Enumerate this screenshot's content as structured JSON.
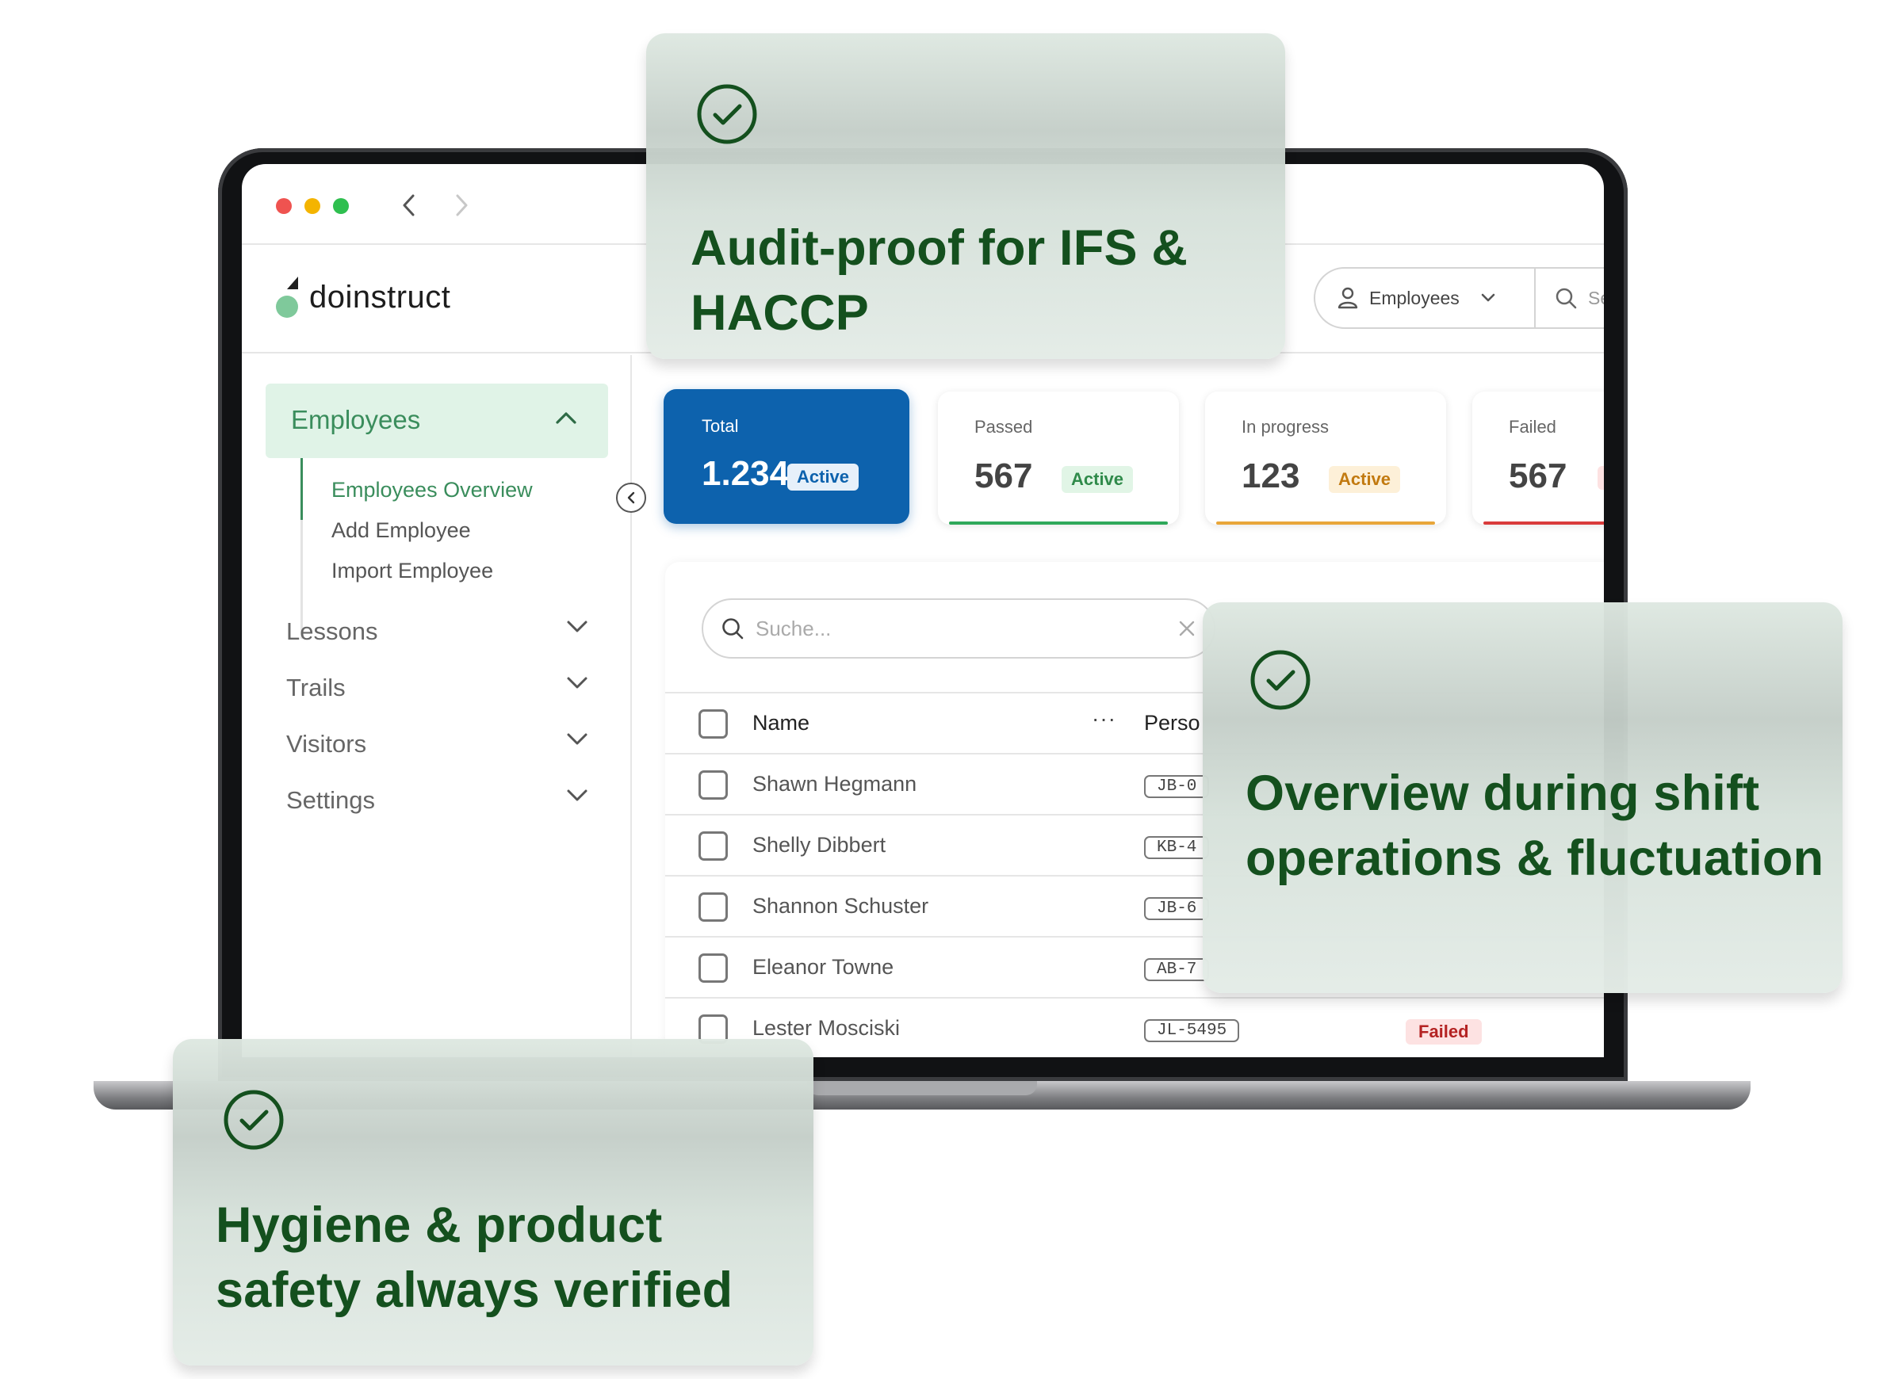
{
  "app": {
    "logo_text": "doinstruct"
  },
  "colors": {
    "brand_green": "#3a8d5c",
    "primary_blue": "#0d62ad",
    "card_text_green": "#14501e",
    "passed_green": "#2fa85a",
    "progress_orange": "#e8a63a",
    "failed_red": "#d93b3b"
  },
  "header": {
    "filter_label": "Employees",
    "filter_icon": "user-icon",
    "search_placeholder": "Se"
  },
  "sidebar": {
    "active_section": {
      "label": "Employees",
      "icon": "chevron-up-icon"
    },
    "sub_items": [
      {
        "label": "Employees Overview"
      },
      {
        "label": "Add Employee"
      },
      {
        "label": "Import Employee"
      }
    ],
    "sections": [
      {
        "label": "Lessons",
        "icon": "chevron-down-icon"
      },
      {
        "label": "Trails",
        "icon": "chevron-down-icon"
      },
      {
        "label": "Visitors",
        "icon": "chevron-down-icon"
      },
      {
        "label": "Settings",
        "icon": "chevron-down-icon"
      }
    ]
  },
  "stats": [
    {
      "title": "Total",
      "value": "1.234",
      "badge": "Active"
    },
    {
      "title": "Passed",
      "value": "567",
      "badge": "Active"
    },
    {
      "title": "In progress",
      "value": "123",
      "badge": "Active"
    },
    {
      "title": "Failed",
      "value": "567",
      "badge": ""
    }
  ],
  "table": {
    "search_placeholder": "Suche...",
    "columns": {
      "name": "Name",
      "more": "···",
      "personnel": "Perso"
    },
    "rows": [
      {
        "name": "Shawn Hegmann",
        "code": "JB-0",
        "status": ""
      },
      {
        "name": "Shelly Dibbert",
        "code": "KB-4",
        "status": ""
      },
      {
        "name": "Shannon Schuster",
        "code": "JB-6",
        "status": ""
      },
      {
        "name": "Eleanor Towne",
        "code": "AB-7",
        "status": ""
      },
      {
        "name": "Lester Mosciski",
        "code": "JL-5495",
        "status": "Failed"
      }
    ]
  },
  "cards": [
    {
      "text": "Audit-proof for IFS & HACCP",
      "icon": "check-circle-icon"
    },
    {
      "text": "Overview during shift operations & fluctuation",
      "icon": "check-circle-icon"
    },
    {
      "text": "Hygiene & product safety always verified",
      "icon": "check-circle-icon"
    }
  ]
}
